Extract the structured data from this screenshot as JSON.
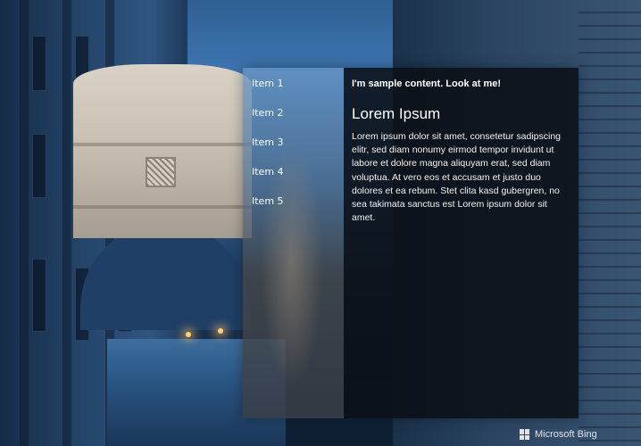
{
  "navigation": {
    "items": [
      {
        "label": "Item 1"
      },
      {
        "label": "Item 2"
      },
      {
        "label": "Item 3"
      },
      {
        "label": "Item 4"
      },
      {
        "label": "Item 5"
      }
    ]
  },
  "content": {
    "sample_text": "I'm sample content. Look at me!",
    "heading": "Lorem Ipsum",
    "body": "Lorem ipsum dolor sit amet, consetetur sadipscing elitr, sed diam nonumy eirmod tempor invidunt ut labore et dolore magna aliquyam erat, sed diam voluptua. At vero eos et accusam et justo duo dolores et ea rebum. Stet clita kasd gubergren, no sea takimata sanctus est Lorem ipsum dolor sit amet."
  },
  "watermark": {
    "label": "Microsoft Bing",
    "icon": "windows-logo-icon"
  }
}
